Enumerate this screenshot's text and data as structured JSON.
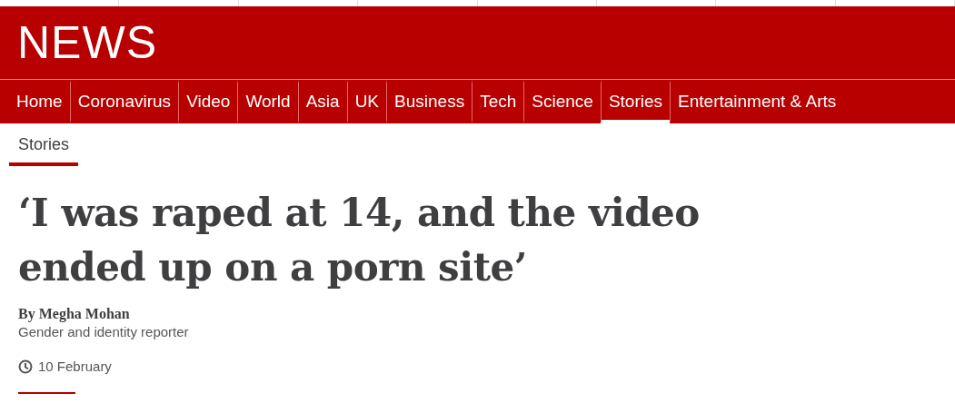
{
  "brand": {
    "logo": "NEWS"
  },
  "nav": [
    {
      "label": "Home",
      "selected": false
    },
    {
      "label": "Coronavirus",
      "selected": false
    },
    {
      "label": "Video",
      "selected": false
    },
    {
      "label": "World",
      "selected": false
    },
    {
      "label": "Asia",
      "selected": false
    },
    {
      "label": "UK",
      "selected": false
    },
    {
      "label": "Business",
      "selected": false
    },
    {
      "label": "Tech",
      "selected": false
    },
    {
      "label": "Science",
      "selected": false
    },
    {
      "label": "Stories",
      "selected": true
    },
    {
      "label": "Entertainment & Arts",
      "selected": false
    }
  ],
  "section": {
    "label": "Stories"
  },
  "article": {
    "headline": "‘I was raped at 14, and the video ended up on a porn site’",
    "byline": "By Megha Mohan",
    "role": "Gender and identity reporter",
    "date": "10 February"
  }
}
